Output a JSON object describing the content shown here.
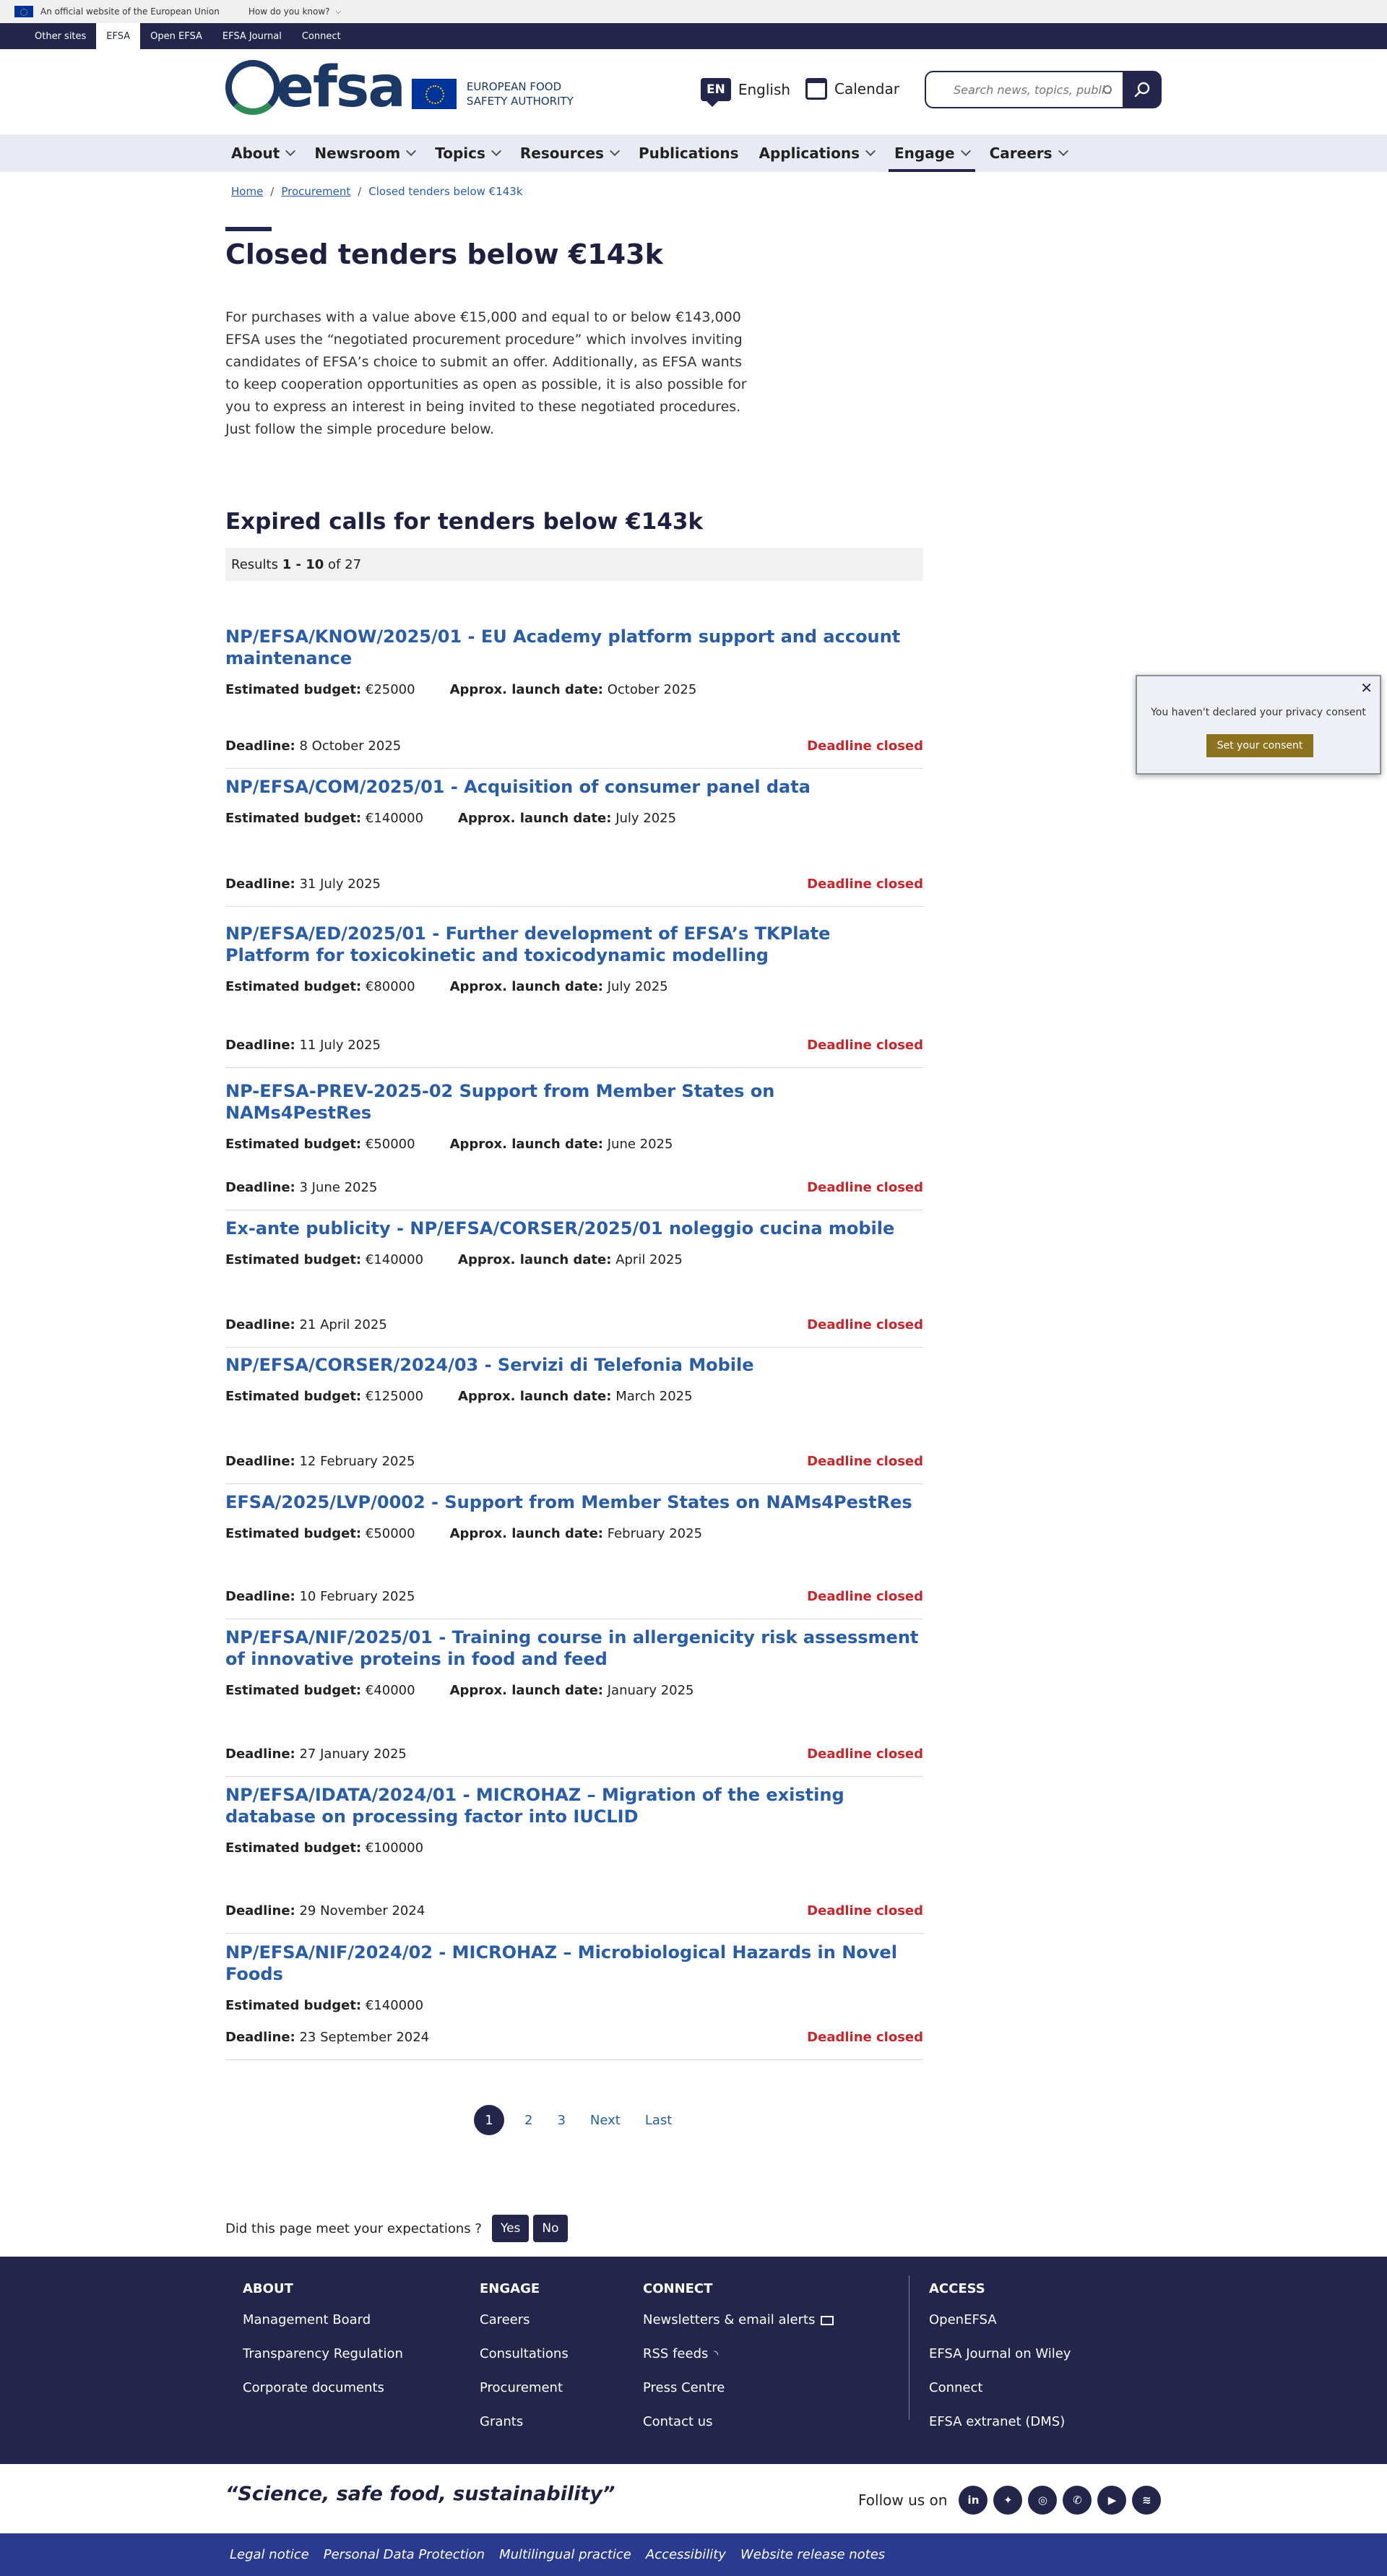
{
  "eu_bar": {
    "official_text": "An official website of the European Union",
    "how_text": "How do you know?"
  },
  "sites": [
    "Other sites",
    "EFSA",
    "Open EFSA",
    "EFSA Journal",
    "Connect"
  ],
  "header": {
    "logo_word": "efsa",
    "logo_text": "European Food Safety Authority",
    "lang_code": "EN",
    "lang_label": "English",
    "calendar_label": "Calendar",
    "search_placeholder": "Search news, topics, publi..."
  },
  "nav": [
    {
      "label": "About",
      "has_menu": true
    },
    {
      "label": "Newsroom",
      "has_menu": true
    },
    {
      "label": "Topics",
      "has_menu": true
    },
    {
      "label": "Resources",
      "has_menu": true
    },
    {
      "label": "Publications",
      "has_menu": false
    },
    {
      "label": "Applications",
      "has_menu": true
    },
    {
      "label": "Engage",
      "has_menu": true,
      "active": true
    },
    {
      "label": "Careers",
      "has_menu": true
    }
  ],
  "breadcrumb": {
    "home": "Home",
    "procurement": "Procurement",
    "current": "Closed tenders below €143k"
  },
  "page": {
    "title": "Closed tenders below €143k",
    "intro": "For purchases with a value above €15,000 and equal to or below €143,000 EFSA uses the “negotiated procurement procedure” which involves inviting candidates of EFSA’s choice to submit an offer. Additionally, as EFSA wants to keep cooperation opportunities as open as possible, it is also possible for you to express an interest in being invited to these negotiated procedures. Just follow the simple procedure below.",
    "subtitle": "Expired calls for tenders below €143k",
    "results": {
      "prefix": "Results",
      "range": "1 - 10",
      "of_text": "of 27"
    }
  },
  "labels": {
    "budget": "Estimated budget:",
    "launch": "Approx. launch date:",
    "deadline": "Deadline:",
    "closed": "Deadline closed"
  },
  "tenders": [
    {
      "title": "NP/EFSA/KNOW/2025/01 - EU Academy platform support and account maintenance",
      "budget": "€25000",
      "launch": "October 2025",
      "deadline": "8 October 2025"
    },
    {
      "title": "NP/EFSA/COM/2025/01 - Acquisition of consumer panel data",
      "budget": "€140000",
      "launch": "July 2025",
      "deadline": "31 July 2025"
    },
    {
      "title": "NP/EFSA/ED/2025/01 - Further development of EFSA’s TKPlate Platform for toxicokinetic and toxicodynamic modelling",
      "budget": "€80000",
      "launch": "July 2025",
      "deadline": "11 July 2025"
    },
    {
      "title": "NP-EFSA-PREV-2025-02 Support from Member States on NAMs4PestRes",
      "budget": "€50000",
      "launch": "June 2025",
      "deadline": "3 June 2025"
    },
    {
      "title": "Ex-ante publicity - NP/EFSA/CORSER/2025/01 noleggio cucina mobile",
      "budget": "€140000",
      "launch": "April 2025",
      "deadline": "21 April 2025"
    },
    {
      "title": "NP/EFSA/CORSER/2024/03 - Servizi di Telefonia Mobile",
      "budget": "€125000",
      "launch": "March 2025",
      "deadline": "12 February 2025"
    },
    {
      "title": "EFSA/2025/LVP/0002 - Support from Member States on NAMs4PestRes",
      "budget": "€50000",
      "launch": "February 2025",
      "deadline": "10 February 2025"
    },
    {
      "title": "NP/EFSA/NIF/2025/01 - Training course in allergenicity risk assessment of innovative proteins in food and feed",
      "budget": "€40000",
      "launch": "January 2025",
      "deadline": "27 January 2025"
    },
    {
      "title": "NP/EFSA/IDATA/2024/01 - MICROHAZ – Migration of the existing database on processing factor into IUCLID",
      "budget": "€100000",
      "launch": null,
      "deadline": "29 November 2024"
    },
    {
      "title": "NP/EFSA/NIF/2024/02 - MICROHAZ – Microbiological Hazards in Novel Foods",
      "budget": "€140000",
      "launch": null,
      "deadline": "23 September 2024"
    }
  ],
  "pager": {
    "current": "1",
    "pages": [
      "2",
      "3"
    ],
    "next": "Next",
    "last": "Last"
  },
  "feedback": {
    "question": "Did this page meet your expectations ?",
    "yes": "Yes",
    "no": "No"
  },
  "footer": {
    "about": {
      "heading": "About",
      "links": [
        "Management Board",
        "Transparency Regulation",
        "Corporate documents"
      ]
    },
    "engage": {
      "heading": "Engage",
      "links": [
        "Careers",
        "Consultations",
        "Procurement",
        "Grants"
      ]
    },
    "connect": {
      "heading": "Connect",
      "links": [
        "Newsletters & email alerts",
        "RSS feeds",
        "Press Centre",
        "Contact us"
      ]
    },
    "access": {
      "heading": "Access",
      "links": [
        "OpenEFSA",
        "EFSA Journal on Wiley",
        "Connect",
        "EFSA extranet (DMS)"
      ]
    }
  },
  "slogan": "“Science, safe food, sustainability”",
  "follow": {
    "label": "Follow us on",
    "icons": [
      "linkedin-icon",
      "bluesky-icon",
      "instagram-icon",
      "whatsapp-icon",
      "youtube-icon",
      "spotify-icon"
    ]
  },
  "legal": [
    "Legal notice",
    "Personal Data Protection",
    "Multilingual practice",
    "Accessibility",
    "Website release notes"
  ],
  "consent": {
    "text": "You haven't declared your privacy consent",
    "button": "Set your consent"
  },
  "colors": {
    "navy": "#23264a",
    "link": "#2a5da8",
    "closed": "#c8262b",
    "consent_btn": "#8d7320",
    "legal_bar": "#2a3a8e"
  }
}
